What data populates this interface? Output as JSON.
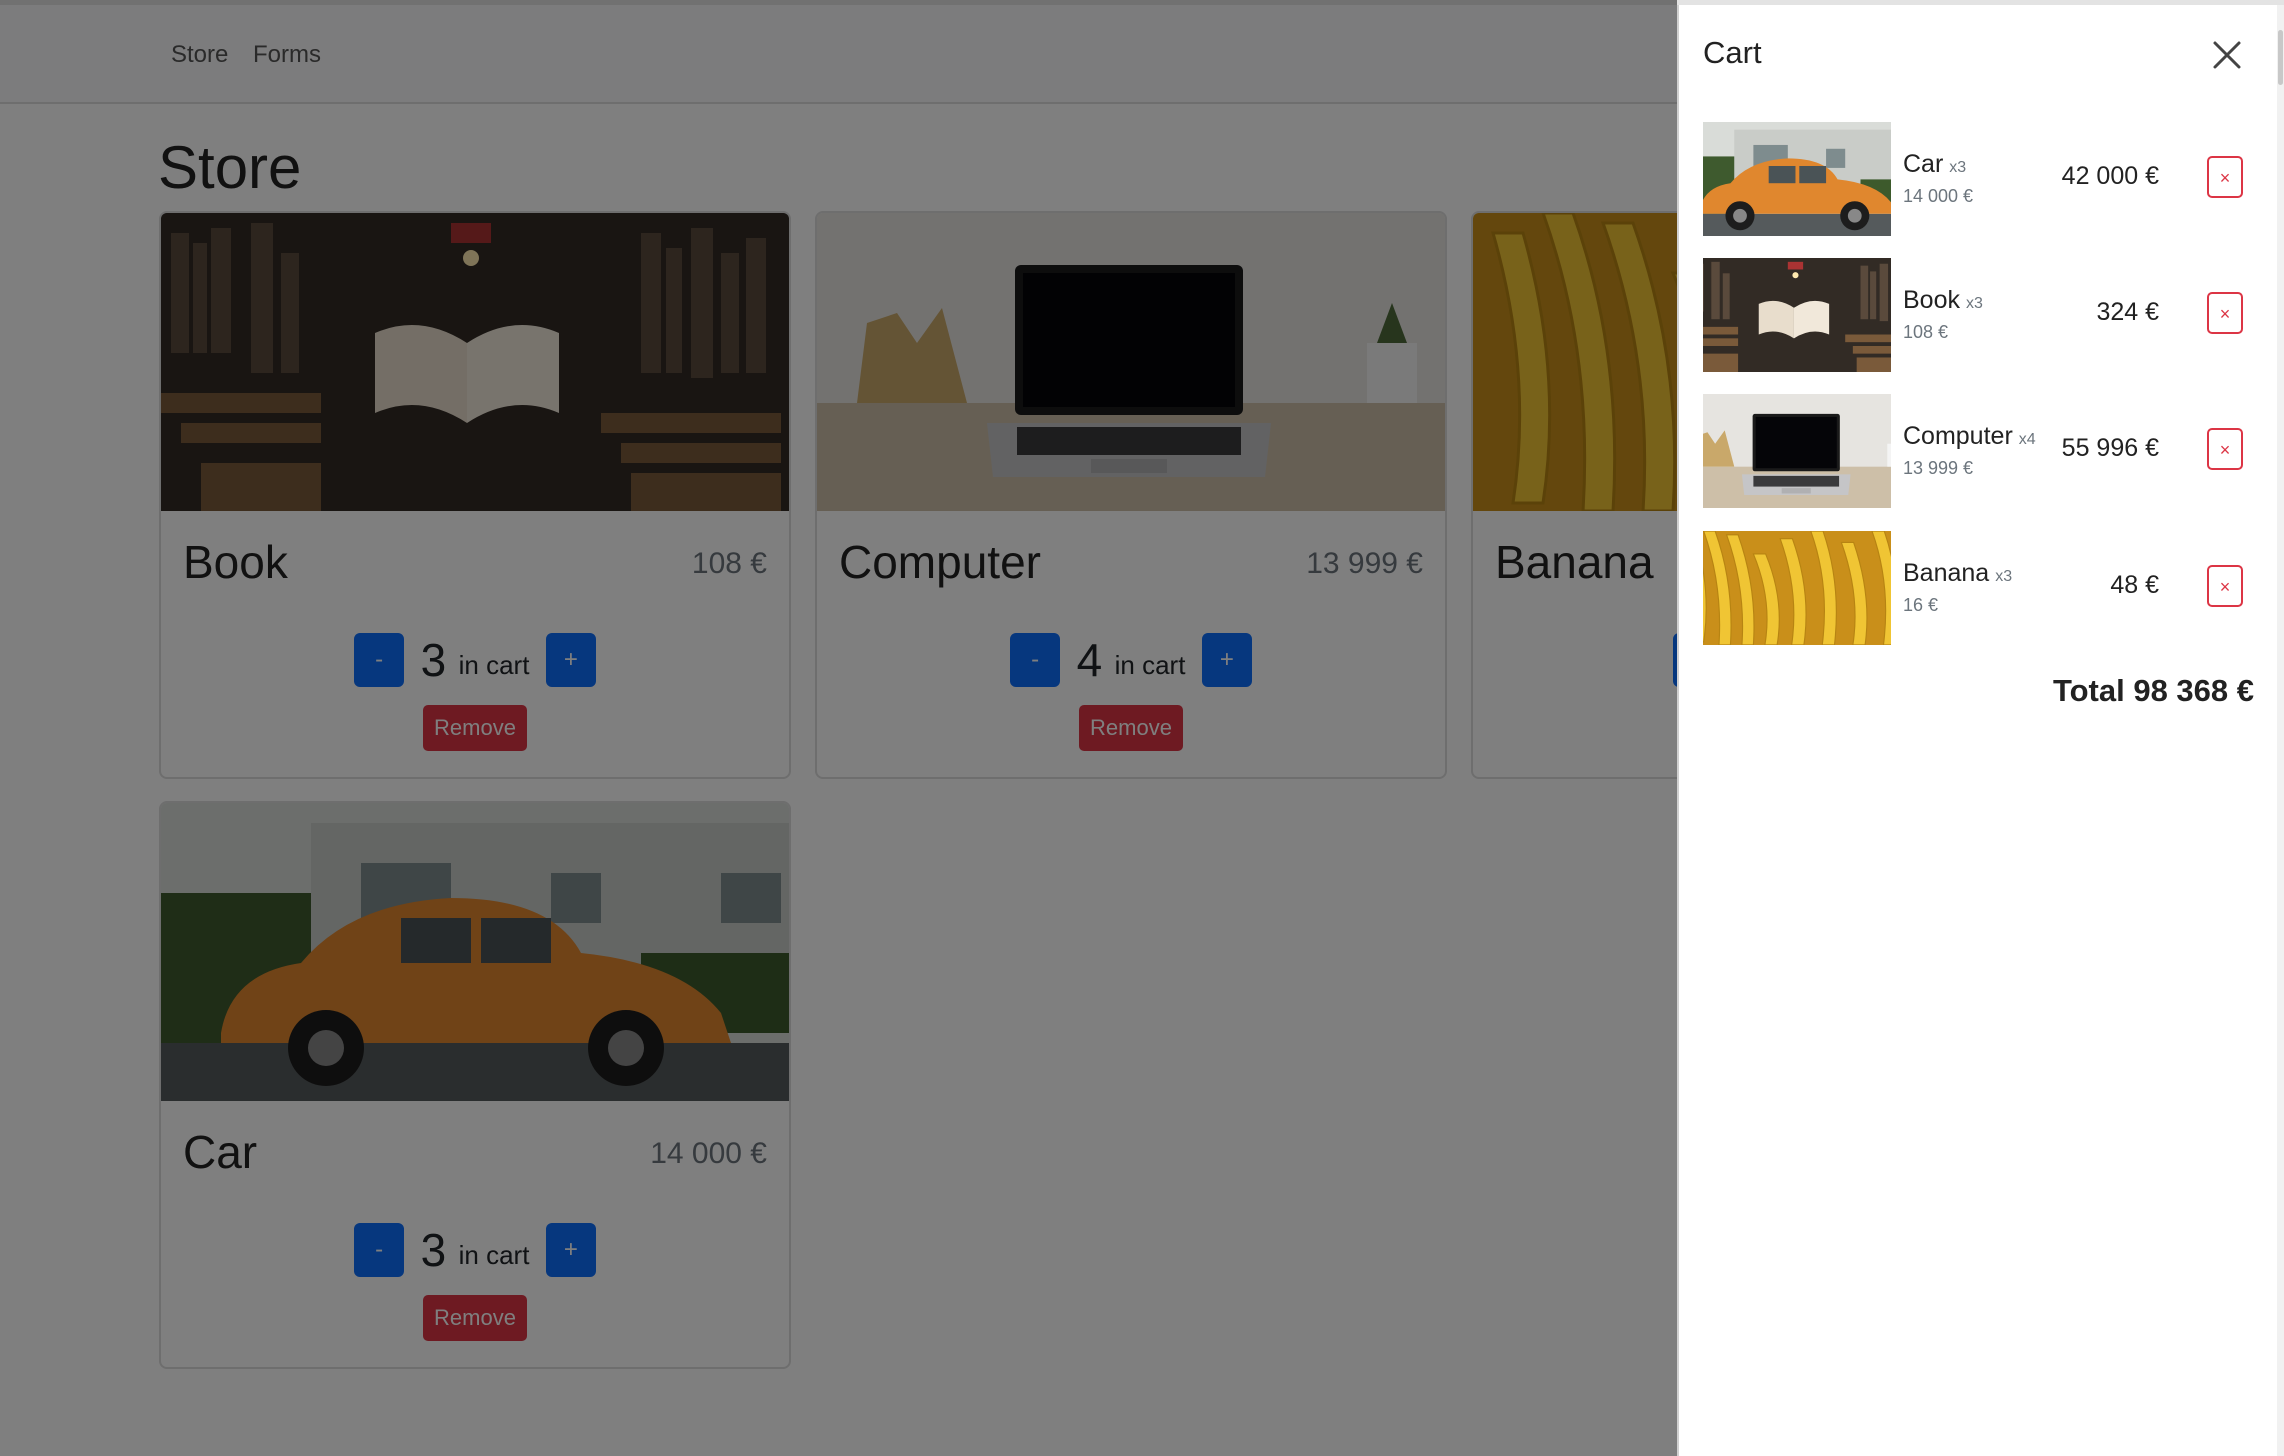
{
  "nav": {
    "links": [
      "Store",
      "Forms"
    ]
  },
  "store": {
    "title": "Store",
    "in_cart_label": "in cart",
    "minus_label": "-",
    "plus_label": "+",
    "remove_label": "Remove",
    "items": [
      {
        "name": "Book",
        "price": "108 €",
        "qty": "3"
      },
      {
        "name": "Computer",
        "price": "13 999 €",
        "qty": "4"
      },
      {
        "name": "Banana",
        "price": "",
        "qty": ""
      },
      {
        "name": "Car",
        "price": "14 000 €",
        "qty": "3"
      }
    ]
  },
  "cart": {
    "title": "Cart",
    "close_icon": "close-icon",
    "remove_symbol": "×",
    "total_label": "Total 98 368 €",
    "items": [
      {
        "name": "Car",
        "qty": "x3",
        "unit_price": "14 000 €",
        "total": "42 000 €"
      },
      {
        "name": "Book",
        "qty": "x3",
        "unit_price": "108 €",
        "total": "324 €"
      },
      {
        "name": "Computer",
        "qty": "x4",
        "unit_price": "13 999 €",
        "total": "55 996 €"
      },
      {
        "name": "Banana",
        "qty": "x3",
        "unit_price": "16 €",
        "total": "48 €"
      }
    ]
  },
  "colors": {
    "primary": "#0d6efd",
    "danger": "#dc3545",
    "overlay": "rgba(0,0,0,0.5)"
  }
}
